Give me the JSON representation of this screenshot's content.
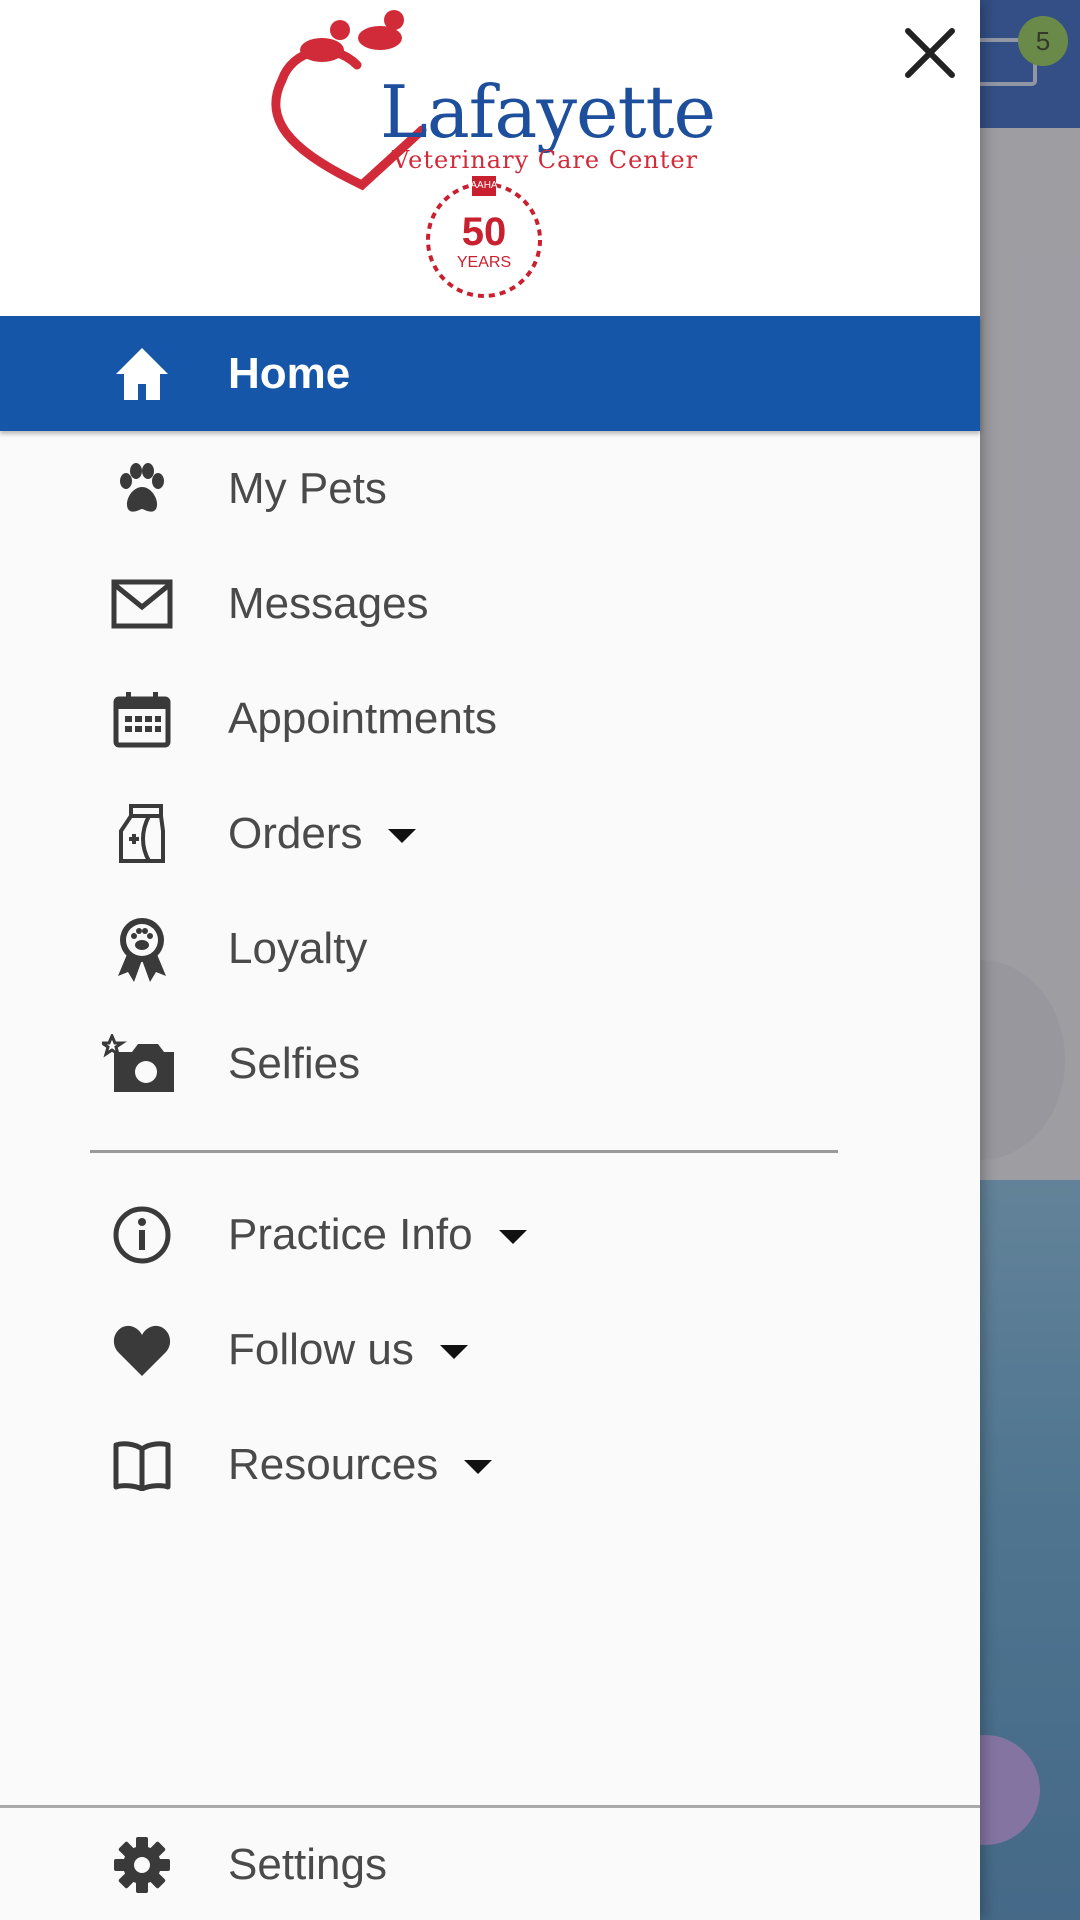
{
  "background": {
    "badge_count": "5"
  },
  "logo": {
    "name": "Lafayette",
    "subtitle": "Veterinary  Care Center",
    "seal_number": "50",
    "seal_text": "YEARS",
    "seal_top": "AAHA"
  },
  "menu": {
    "items": [
      {
        "label": "Home",
        "icon": "home-icon"
      },
      {
        "label": "My Pets",
        "icon": "paw-icon"
      },
      {
        "label": "Messages",
        "icon": "envelope-icon"
      },
      {
        "label": "Appointments",
        "icon": "calendar-icon"
      },
      {
        "label": "Orders",
        "icon": "pet-food-bag-icon"
      },
      {
        "label": "Loyalty",
        "icon": "award-ribbon-icon"
      },
      {
        "label": "Selfies",
        "icon": "camera-icon"
      },
      {
        "label": "Practice Info",
        "icon": "info-icon"
      },
      {
        "label": "Follow us",
        "icon": "heart-icon"
      },
      {
        "label": "Resources",
        "icon": "book-icon"
      }
    ],
    "settings": {
      "label": "Settings",
      "icon": "gear-icon"
    }
  },
  "colors": {
    "active_item": "#1556a8",
    "brand_blue": "#1d4f9c",
    "brand_red": "#d12b3a"
  }
}
